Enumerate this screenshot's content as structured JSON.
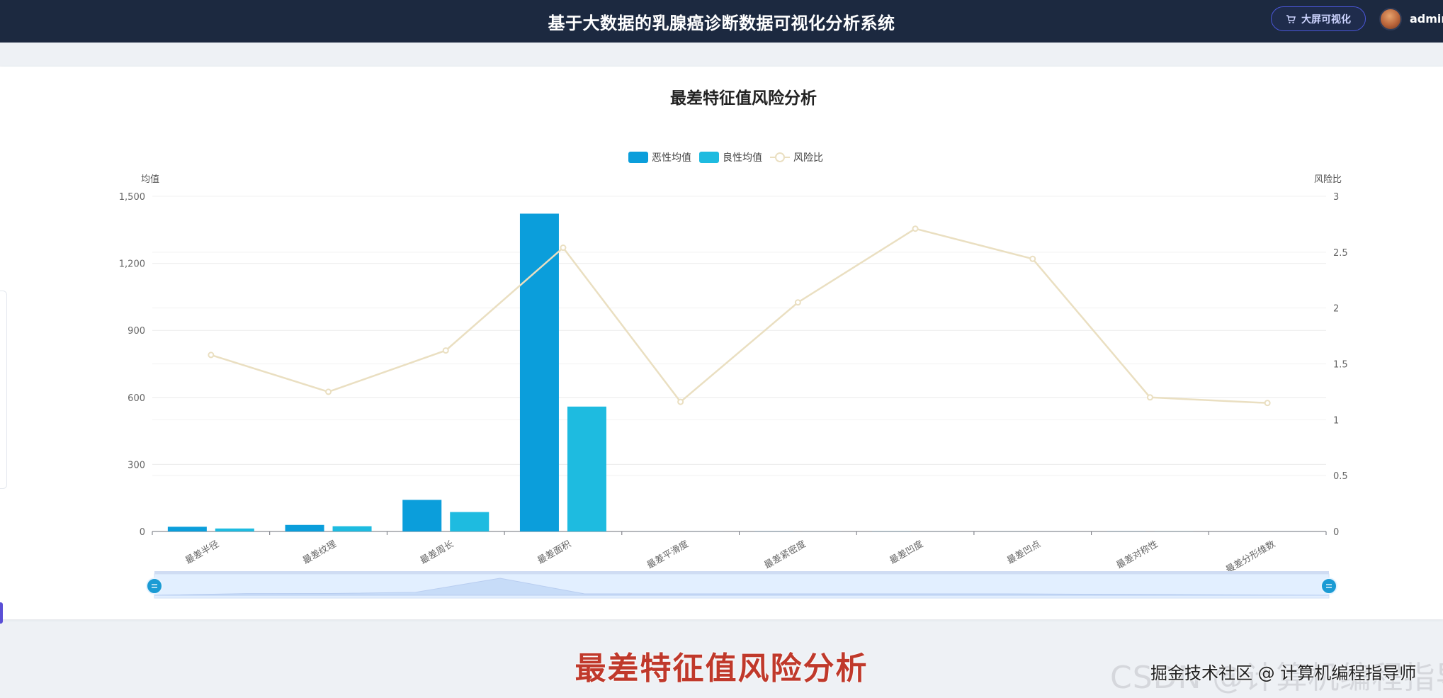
{
  "header": {
    "app_title": "基于大数据的乳腺癌诊断数据可视化分析系统",
    "bigscreen_label": "大屏可视化",
    "username": "admin"
  },
  "chart_data": {
    "type": "bar",
    "title": "最差特征值风险分析",
    "categories": [
      "最差半径",
      "最差纹理",
      "最差周长",
      "最差面积",
      "最差平滑度",
      "最差紧密度",
      "最差凹度",
      "最差凹点",
      "最差对称性",
      "最差分形维数"
    ],
    "series": [
      {
        "name": "恶性均值",
        "type": "bar",
        "axis": "left",
        "color": "#0b9edb",
        "values": [
          21.1,
          29.3,
          141.4,
          1422.3,
          0.14,
          0.38,
          0.45,
          0.18,
          0.32,
          0.09
        ]
      },
      {
        "name": "良性均值",
        "type": "bar",
        "axis": "left",
        "color": "#1ebbe0",
        "values": [
          13.4,
          23.5,
          87.0,
          558.9,
          0.12,
          0.18,
          0.17,
          0.07,
          0.27,
          0.08
        ]
      },
      {
        "name": "风险比",
        "type": "line",
        "axis": "right",
        "color": "#eadfc1",
        "values": [
          1.58,
          1.25,
          1.62,
          2.54,
          1.16,
          2.05,
          2.71,
          2.44,
          1.2,
          1.15
        ]
      }
    ],
    "ylabel": "均值",
    "ylabel_right": "风险比",
    "ylim": [
      0,
      1500
    ],
    "ylim_right": [
      0,
      3
    ],
    "yticks": [
      0,
      300,
      600,
      900,
      1200,
      1500
    ],
    "ytick_labels": [
      "0",
      "300",
      "600",
      "900",
      "1,200",
      "1,500"
    ],
    "yticks_right": [
      0,
      0.5,
      1,
      1.5,
      2,
      2.5,
      3
    ],
    "ytick_labels_right": [
      "0",
      "0.5",
      "1",
      "1.5",
      "2",
      "2.5",
      "3"
    ],
    "legend": "top-center",
    "grid": true,
    "datazoom": true
  },
  "caption": "最差特征值风险分析",
  "watermark": "CSDN @计算机编程指导师",
  "credit": "掘金技术社区 @ 计算机编程指导师"
}
